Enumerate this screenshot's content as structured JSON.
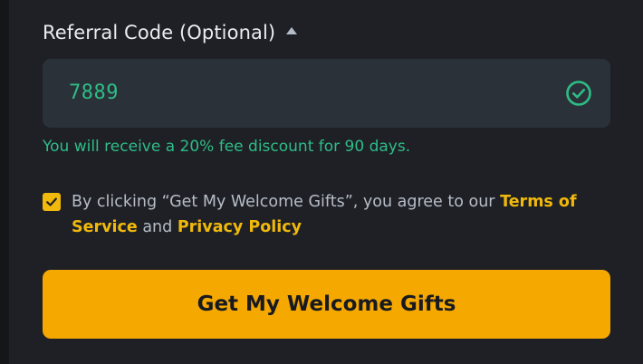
{
  "referral": {
    "label": "Referral Code (Optional)",
    "toggle_icon": "caret-up-icon",
    "value": "7889",
    "status_icon": "check-circle-icon",
    "hint": "You will receive a 20% fee discount for 90 days."
  },
  "agreement": {
    "checked": true,
    "text_before": "By clicking “Get My Welcome Gifts”, you agree to our ",
    "terms_link": "Terms of Service",
    "text_middle": " and ",
    "privacy_link": "Privacy Policy"
  },
  "cta": {
    "label": "Get My Welcome Gifts"
  },
  "colors": {
    "background": "#1e2026",
    "input_background": "#2b3139",
    "success": "#2ebd85",
    "accent": "#f0b90b",
    "button": "#f5a800",
    "text_primary": "#eaecef",
    "text_secondary": "#b7bdc6"
  }
}
